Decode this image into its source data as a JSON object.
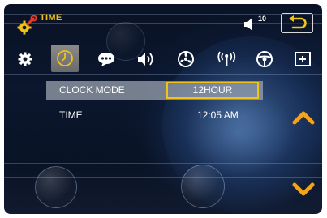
{
  "header": {
    "title": "TIME",
    "volume_level": "10"
  },
  "toolbar": {
    "items": [
      {
        "icon": "gear-icon"
      },
      {
        "icon": "clock-icon",
        "selected": true
      },
      {
        "icon": "chat-bubble-icon"
      },
      {
        "icon": "speaker-icon"
      },
      {
        "icon": "fan-icon"
      },
      {
        "icon": "antenna-icon"
      },
      {
        "icon": "steering-wheel-icon"
      },
      {
        "icon": "plus-box-icon"
      }
    ]
  },
  "settings": {
    "rows": [
      {
        "label": "CLOCK MODE",
        "value": "12HOUR"
      },
      {
        "label": "TIME",
        "value": "12:05 AM"
      }
    ]
  },
  "colors": {
    "accent": "#f0c21a",
    "arrow": "#f5a318",
    "background": "#0d1a33"
  }
}
